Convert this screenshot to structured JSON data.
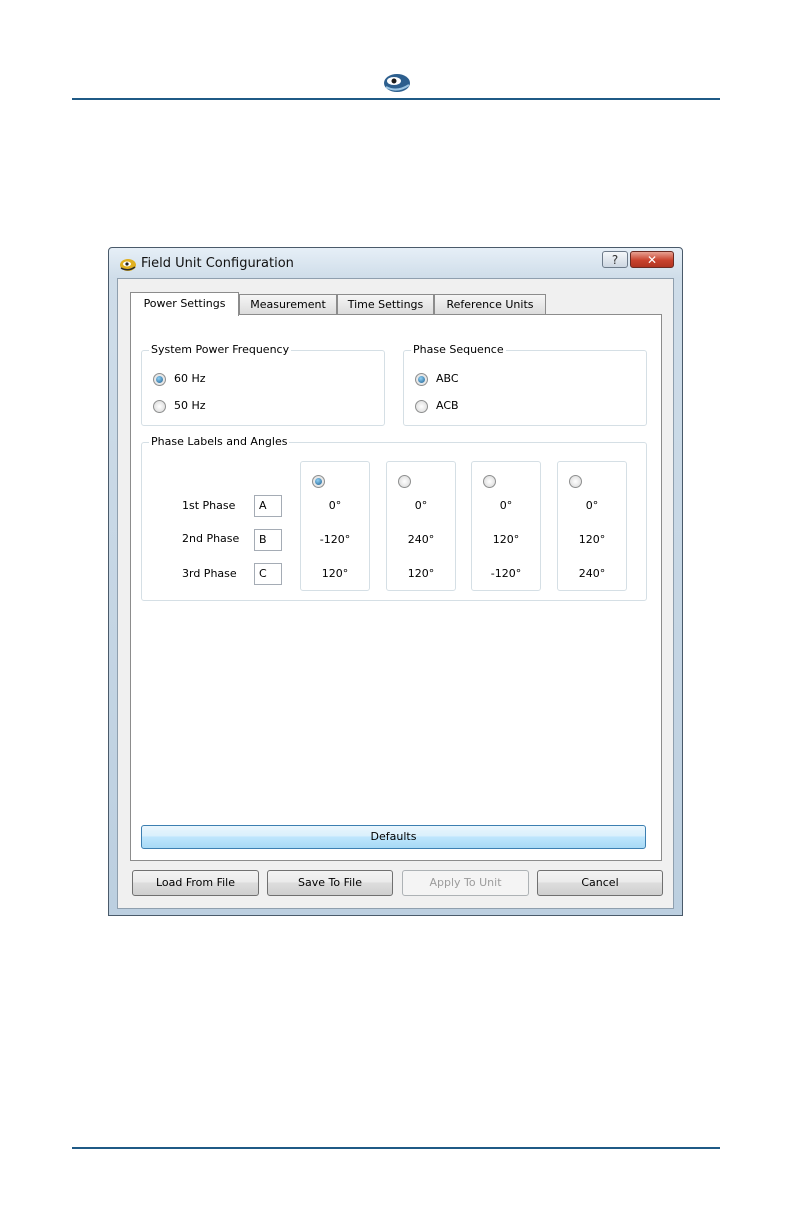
{
  "window": {
    "title": "Field Unit Configuration",
    "help_glyph": "?",
    "close_glyph": "✕"
  },
  "tabs": [
    {
      "label": "Power Settings",
      "active": true
    },
    {
      "label": "Measurement",
      "active": false
    },
    {
      "label": "Time Settings",
      "active": false
    },
    {
      "label": "Reference Units",
      "active": false
    }
  ],
  "frequency": {
    "title": "System Power Frequency",
    "options": [
      {
        "label": "60 Hz",
        "checked": true
      },
      {
        "label": "50 Hz",
        "checked": false
      }
    ]
  },
  "sequence": {
    "title": "Phase Sequence",
    "options": [
      {
        "label": "ABC",
        "checked": true
      },
      {
        "label": "ACB",
        "checked": false
      }
    ]
  },
  "phases": {
    "title": "Phase Labels and Angles",
    "rows": [
      {
        "label": "1st Phase",
        "value": "A"
      },
      {
        "label": "2nd Phase",
        "value": "B"
      },
      {
        "label": "3rd Phase",
        "value": "C"
      }
    ],
    "angle_sets": [
      {
        "checked": true,
        "angles": [
          "0°",
          "-120°",
          "120°"
        ]
      },
      {
        "checked": false,
        "angles": [
          "0°",
          "240°",
          "120°"
        ]
      },
      {
        "checked": false,
        "angles": [
          "0°",
          "120°",
          "-120°"
        ]
      },
      {
        "checked": false,
        "angles": [
          "0°",
          "120°",
          "240°"
        ]
      }
    ]
  },
  "buttons": {
    "defaults": "Defaults",
    "load": "Load From File",
    "save": "Save To File",
    "apply": "Apply To Unit",
    "cancel": "Cancel"
  },
  "colors": {
    "rule": "#1f5a86",
    "accent": "#3c7fb1",
    "close": "#c9432e"
  }
}
